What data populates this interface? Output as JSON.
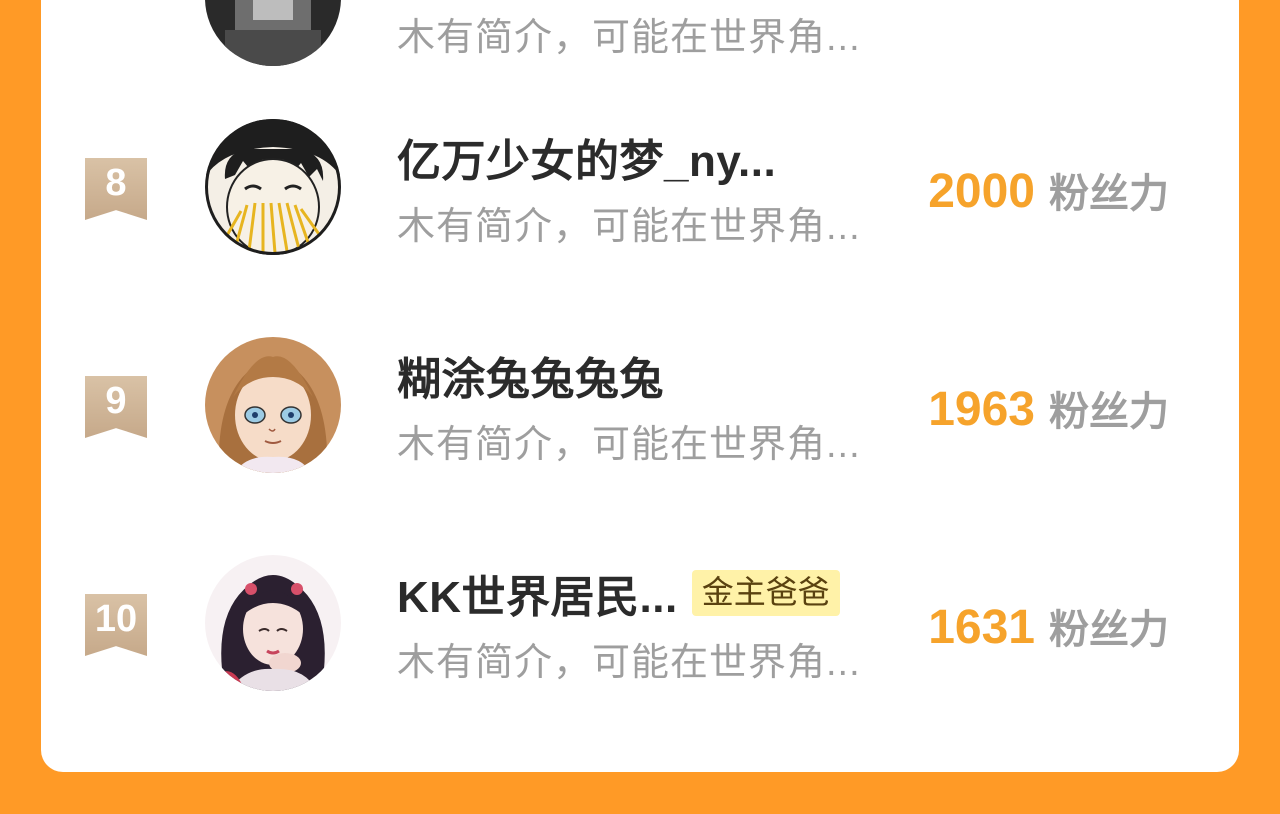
{
  "list": {
    "rows": [
      {
        "rank": "",
        "name": "",
        "badge": "",
        "bio": "木有简介，可能在世界角...",
        "score": "",
        "unit": "",
        "avatar": "dark-hair-avatar"
      },
      {
        "rank": "8",
        "name": "亿万少女的梦_ny...",
        "badge": "",
        "bio": "木有简介，可能在世界角...",
        "score": "2000",
        "unit": "粉丝力",
        "avatar": "boy-eating-noodles-avatar"
      },
      {
        "rank": "9",
        "name": "糊涂兔兔兔兔",
        "badge": "",
        "bio": "木有简介，可能在世界角...",
        "score": "1963",
        "unit": "粉丝力",
        "avatar": "anime-girl-avatar"
      },
      {
        "rank": "10",
        "name": "KK世界居民...",
        "badge": "金主爸爸",
        "bio": "木有简介，可能在世界角...",
        "score": "1631",
        "unit": "粉丝力",
        "avatar": "illustrated-girl-avatar"
      }
    ]
  },
  "colors": {
    "background": "#FF9A26",
    "card": "#FFFFFF",
    "score": "#F6A32B",
    "muted": "#9E9E9E",
    "name": "#2B2B2B",
    "rank_badge": "#C6A98A",
    "vip_badge_bg": "#FFF2A8"
  }
}
